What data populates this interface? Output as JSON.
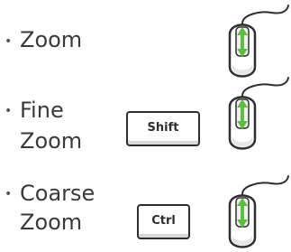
{
  "rows": [
    {
      "bullet": "•",
      "label_lines": [
        "Zoom"
      ],
      "key": null,
      "mouse_icon": "mouse-scroll-wheel-icon"
    },
    {
      "bullet": "•",
      "label_lines": [
        "Fine",
        "Zoom"
      ],
      "key": "Shift",
      "mouse_icon": "mouse-scroll-wheel-icon"
    },
    {
      "bullet": "•",
      "label_lines": [
        "Coarse",
        "Zoom"
      ],
      "key": "Ctrl",
      "mouse_icon": "mouse-scroll-wheel-icon"
    }
  ],
  "colors": {
    "text": "#3a3a3a",
    "outline": "#2e2e2e",
    "arrow_green": "#5cbf3f",
    "mouse_body": "#ffffff",
    "mouse_shade": "#e6e6e6"
  }
}
